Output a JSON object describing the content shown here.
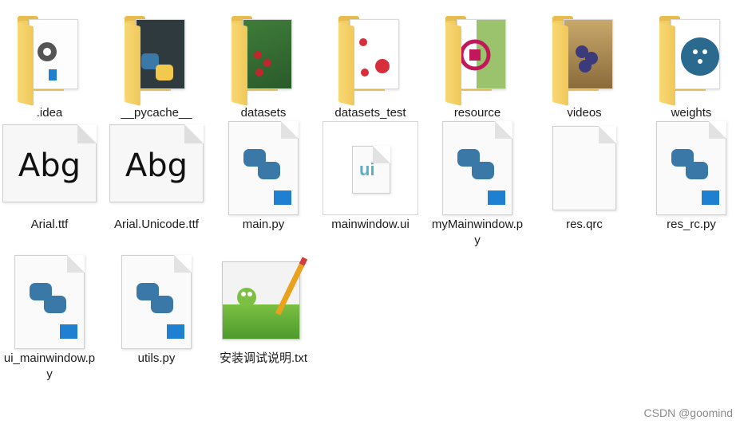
{
  "files": [
    {
      "name": ".idea",
      "type": "folder",
      "icon": "vscode-folder-icon"
    },
    {
      "name": "__pycache__",
      "type": "folder",
      "icon": "python-folder-icon"
    },
    {
      "name": "datasets",
      "type": "folder",
      "icon": "image-folder-icon"
    },
    {
      "name": "datasets_test",
      "type": "folder",
      "icon": "image-folder-icon"
    },
    {
      "name": "resource",
      "type": "folder",
      "icon": "image-folder-icon"
    },
    {
      "name": "videos",
      "type": "folder",
      "icon": "image-folder-icon"
    },
    {
      "name": "weights",
      "type": "folder",
      "icon": "neural-network-folder-icon"
    },
    {
      "name": "Arial.ttf",
      "type": "font",
      "icon": "font-file-icon",
      "preview": "Abg"
    },
    {
      "name": "Arial.Unicode.ttf",
      "type": "font",
      "icon": "font-file-icon",
      "preview": "Abg"
    },
    {
      "name": "main.py",
      "type": "python",
      "icon": "python-file-icon"
    },
    {
      "name": "mainwindow.ui",
      "type": "ui",
      "icon": "ui-file-icon",
      "badge": "ui"
    },
    {
      "name": "myMainwindow.py",
      "type": "python",
      "icon": "python-file-icon"
    },
    {
      "name": "res.qrc",
      "type": "blank",
      "icon": "blank-file-icon"
    },
    {
      "name": "res_rc.py",
      "type": "python",
      "icon": "python-file-icon"
    },
    {
      "name": "ui_mainwindow.py",
      "type": "python",
      "icon": "python-file-icon"
    },
    {
      "name": "utils.py",
      "type": "python",
      "icon": "python-file-icon"
    },
    {
      "name": "安装调试说明.txt",
      "type": "text",
      "icon": "notepad-plus-plus-icon"
    }
  ],
  "watermark": "CSDN @goomind",
  "colors": {
    "folder": "#f2cd66",
    "python_blue": "#3a78a8",
    "python_yellow": "#f2c94c",
    "vscode_blue": "#1f7fd0"
  }
}
